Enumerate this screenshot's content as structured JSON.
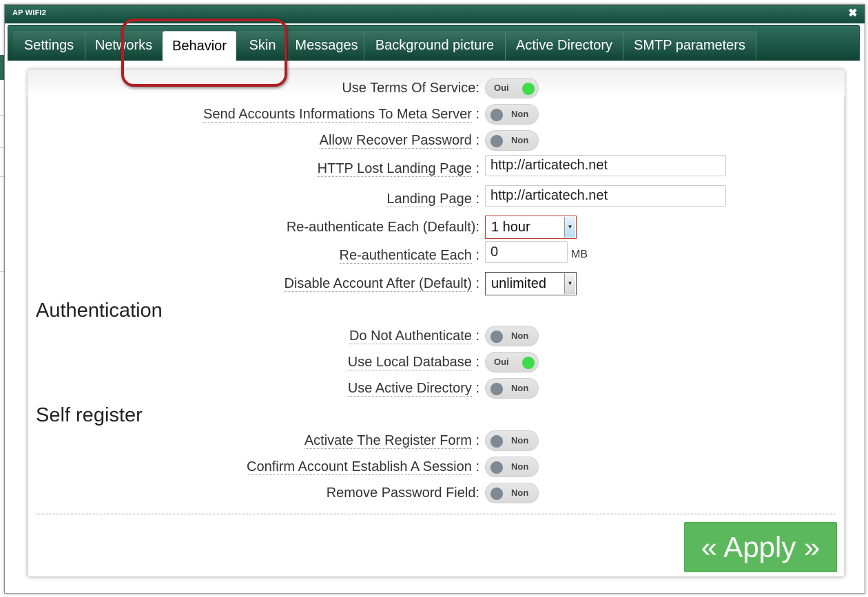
{
  "window": {
    "title": "AP WIFI2",
    "close_glyph": "✖"
  },
  "tabs": [
    {
      "label": "Settings",
      "active": false
    },
    {
      "label": "Networks",
      "active": false
    },
    {
      "label": "Behavior",
      "active": true
    },
    {
      "label": "Skin",
      "active": false
    },
    {
      "label": "Messages",
      "active": false
    },
    {
      "label": "Background picture",
      "active": false
    },
    {
      "label": "Active Directory",
      "active": false
    },
    {
      "label": "SMTP parameters",
      "active": false
    }
  ],
  "form": {
    "use_tos": {
      "label": "Use Terms Of Service:",
      "state": "Oui"
    },
    "send_meta": {
      "label": "Send Accounts Informations To Meta Server",
      "state": "Non"
    },
    "allow_recover": {
      "label": "Allow Recover Password",
      "state": "Non"
    },
    "http_lost": {
      "label": "HTTP Lost Landing Page",
      "value": "http://articatech.net"
    },
    "landing": {
      "label": "Landing Page",
      "value": "http://articatech.net"
    },
    "reauth_default": {
      "label": "Re-authenticate Each (Default):",
      "value": "1 hour"
    },
    "reauth_each": {
      "label": "Re-authenticate Each",
      "value": "0",
      "unit": "MB"
    },
    "disable_after": {
      "label": "Disable Account After (Default)",
      "value": "unlimited"
    },
    "colon": ":"
  },
  "authentication": {
    "title": "Authentication",
    "do_not_auth": {
      "label": "Do Not Authenticate",
      "state": "Non"
    },
    "local_db": {
      "label": "Use Local Database",
      "state": "Oui"
    },
    "active_directory": {
      "label": "Use Active Directory",
      "state": "Non"
    }
  },
  "self_register": {
    "title": "Self register",
    "activate_form": {
      "label": "Activate The Register Form",
      "state": "Non"
    },
    "confirm_session": {
      "label": "Confirm Account Establish A Session",
      "state": "Non"
    },
    "remove_password": {
      "label": "Remove Password Field:",
      "state": "Non"
    }
  },
  "apply": {
    "label": "« Apply »"
  },
  "colors": {
    "header_green": "#144a3a",
    "toggle_on": "#3fdc4a",
    "toggle_off": "#7d8a95",
    "apply_green": "#5cb85c",
    "highlight_red": "#b01e24"
  }
}
